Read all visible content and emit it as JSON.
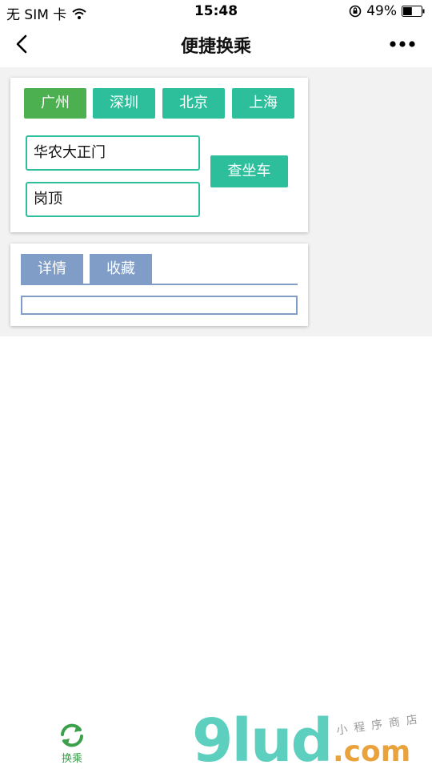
{
  "status_bar": {
    "carrier": "无 SIM 卡",
    "time": "15:48",
    "battery": "49%",
    "battery_level": 0.49
  },
  "nav": {
    "title": "便捷换乘",
    "back_icon": "chevron-left-icon",
    "more_icon": "more-dots-icon"
  },
  "cities": [
    {
      "label": "广州",
      "active": true
    },
    {
      "label": "深圳",
      "active": false
    },
    {
      "label": "北京",
      "active": false
    },
    {
      "label": "上海",
      "active": false
    }
  ],
  "form": {
    "origin": "华农大正门",
    "destination": "岗顶",
    "search_label": "查坐车"
  },
  "tabs": [
    {
      "label": "详情"
    },
    {
      "label": "收藏"
    }
  ],
  "bottom_tab": {
    "label": "换乘",
    "icon": "refresh-icon"
  },
  "watermark": {
    "brand": "9lud",
    "domain": ".com",
    "tagline": "小程序商店"
  },
  "colors": {
    "city_active": "#4caf50",
    "city_inactive": "#2dbf9b",
    "search_button": "#2dbf9b",
    "tab": "#7f9dc7",
    "bottom_tab": "#3aa04a"
  }
}
